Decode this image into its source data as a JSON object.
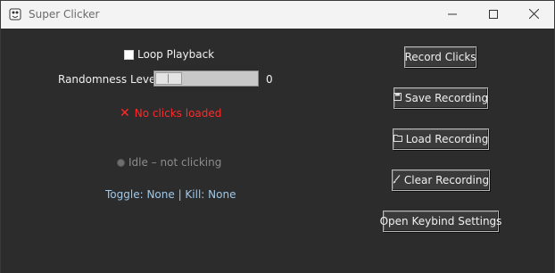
{
  "window": {
    "title": "Super Clicker",
    "app_icon": "app-icon",
    "controls": {
      "minimize": "minimize-icon",
      "maximize": "maximize-icon",
      "close": "close-icon"
    }
  },
  "left": {
    "loop_label": "Loop Playback",
    "loop_checked": false,
    "randomness_label": "Randomness Level:",
    "randomness_value": "0",
    "randomness_fraction": 0,
    "clicks_status": "No clicks loaded",
    "clicks_status_icon": "x-icon",
    "clicks_status_color": "#ff2a2a",
    "idle_status": "Idle – not clicking",
    "hotkeys": "Toggle: None | Kill: None",
    "hotkeys_color": "#9fc8e8"
  },
  "buttons": {
    "record": "Record Clicks",
    "save": "Save Recording",
    "save_icon": "floppy-disk-icon",
    "load": "Load Recording",
    "load_icon": "folder-icon",
    "clear": "Clear Recording",
    "clear_icon": "brush-icon",
    "keybind": "Open Keybind Settings"
  }
}
